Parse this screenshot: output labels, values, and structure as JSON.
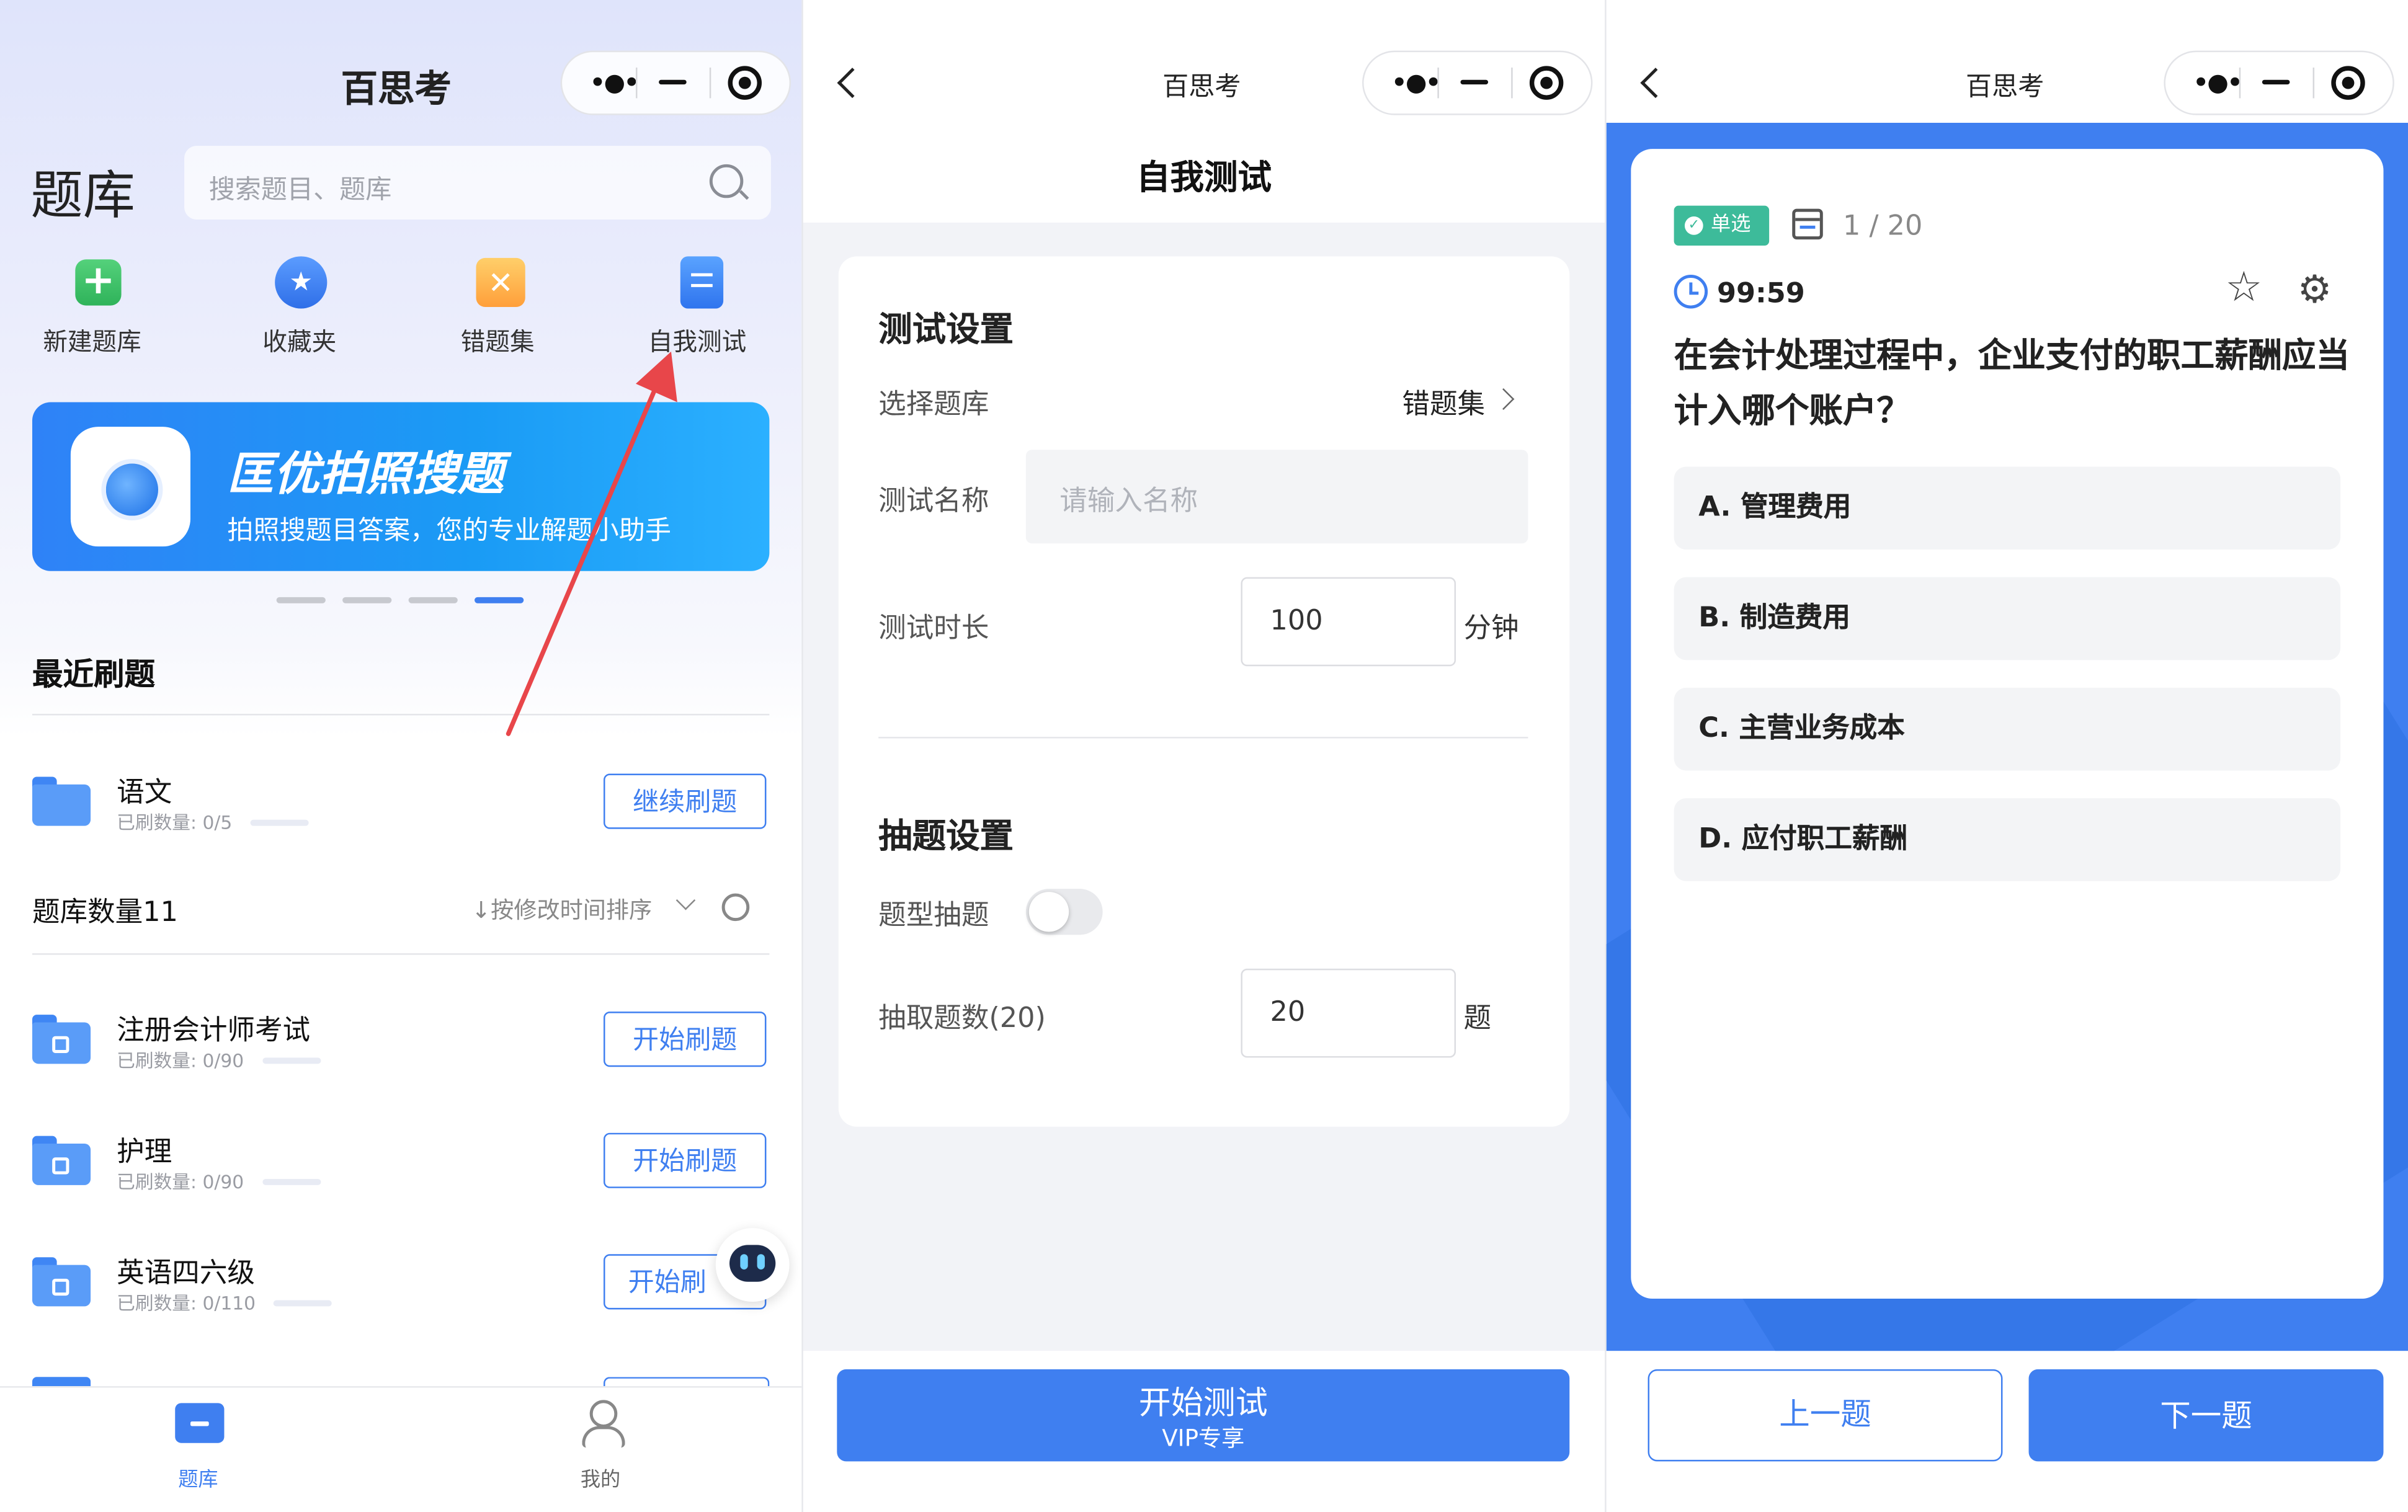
{
  "panel1": {
    "app_title": "百思考",
    "header_title": "题库",
    "search_placeholder": "搜索题目、题库",
    "quick_actions": [
      {
        "label": "新建题库",
        "icon": "plus-icon"
      },
      {
        "label": "收藏夹",
        "icon": "star-icon"
      },
      {
        "label": "错题集",
        "icon": "x-icon"
      },
      {
        "label": "自我测试",
        "icon": "document-icon"
      }
    ],
    "banner": {
      "title": "匡优拍照搜题",
      "subtitle": "拍照搜题目答案，您的专业解题小助手"
    },
    "recent_title": "最近刷题",
    "recent_item": {
      "title": "语文",
      "sub": "已刷数量: 0/5",
      "progress": 0,
      "button": "继续刷题"
    },
    "bank_count_label": "题库数量11",
    "sort_label": "↓按修改时间排序",
    "banks": [
      {
        "title": "注册会计师考试",
        "sub": "已刷数量: 0/90",
        "progress": 0,
        "button": "开始刷题"
      },
      {
        "title": "护理",
        "sub": "已刷数量: 0/90",
        "progress": 0,
        "button": "开始刷题"
      },
      {
        "title": "英语四六级",
        "sub": "已刷数量: 0/110",
        "progress": 0,
        "button": "开始刷"
      }
    ],
    "tabbar": [
      {
        "label": "题库",
        "active": true
      },
      {
        "label": "我的",
        "active": false
      }
    ],
    "colors": {
      "accent": "#3f7ff0",
      "arrow": "#e8464a"
    }
  },
  "panel2": {
    "app_title": "百思考",
    "page_title": "自我测试",
    "test_settings_heading": "测试设置",
    "select_bank_label": "选择题库",
    "select_bank_value": "错题集",
    "test_name_label": "测试名称",
    "test_name_placeholder": "请输入名称",
    "test_duration_label": "测试时长",
    "test_duration_value": "100",
    "test_duration_unit": "分钟",
    "draw_settings_heading": "抽题设置",
    "type_draw_label": "题型抽题",
    "type_draw_on": false,
    "draw_count_label": "抽取题数(20)",
    "draw_count_value": "20",
    "draw_count_unit": "题",
    "start_button": "开始测试",
    "start_button_sub": "VIP专享"
  },
  "panel3": {
    "app_title": "百思考",
    "badge": "单选",
    "progress_text": "1 / 20",
    "timer": "99:59",
    "question": "在会计处理过程中，企业支付的职工薪酬应当计入哪个账户？",
    "options": [
      "A. 管理费用",
      "B. 制造费用",
      "C. 主营业务成本",
      "D. 应付职工薪酬"
    ],
    "prev_button": "上一题",
    "next_button": "下一题",
    "colors": {
      "badge": "#3dbb9a",
      "accent": "#3f7ff0"
    }
  }
}
